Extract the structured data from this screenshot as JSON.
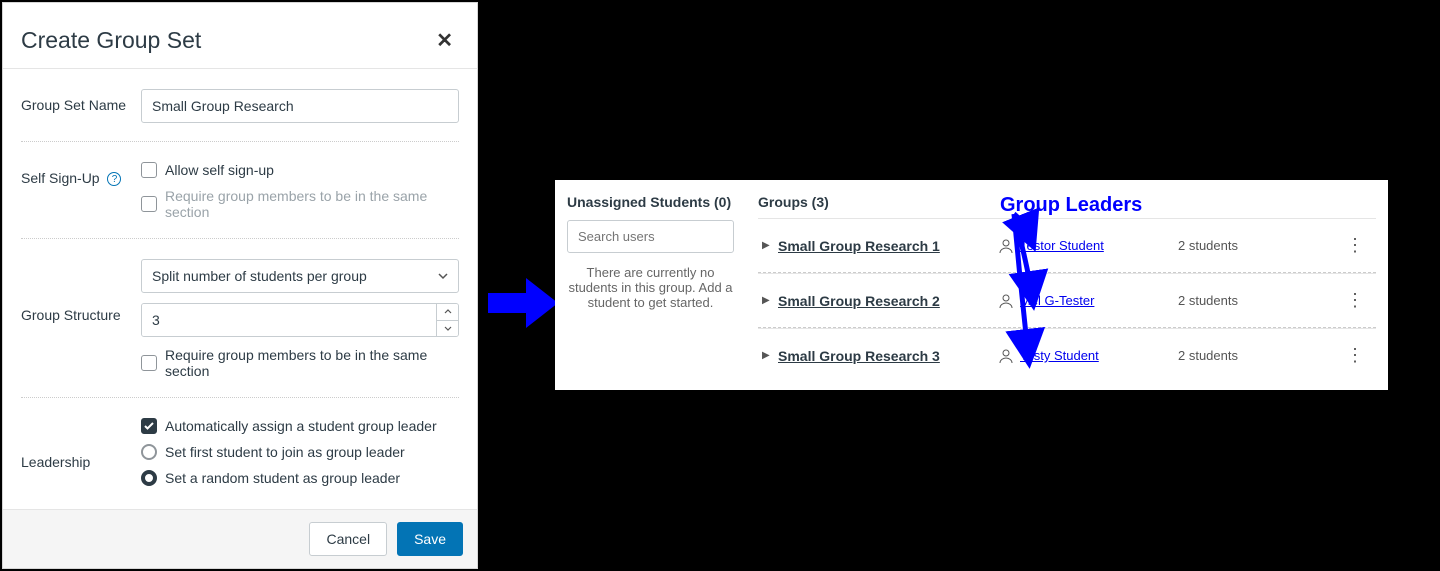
{
  "dialog": {
    "title": "Create Group Set",
    "group_set_name": {
      "label": "Group Set Name",
      "value": "Small Group Research"
    },
    "self_signup": {
      "label": "Self Sign-Up",
      "allow_label": "Allow self sign-up",
      "allow_checked": false,
      "same_section_label": "Require group members to be in the same section",
      "same_section_checked": false
    },
    "structure": {
      "label": "Group Structure",
      "split_option": "Split number of students per group",
      "count_value": "3",
      "same_section_label": "Require group members to be in the same section",
      "same_section_checked": false
    },
    "leadership": {
      "label": "Leadership",
      "auto_assign_label": "Automatically assign a student group leader",
      "auto_assign_checked": true,
      "radio_first_label": "Set first student to join as group leader",
      "radio_random_label": "Set a random student as group leader",
      "selected": "random"
    },
    "buttons": {
      "cancel": "Cancel",
      "save": "Save"
    }
  },
  "groups_panel": {
    "unassigned_title": "Unassigned Students (0)",
    "search_placeholder": "Search users",
    "empty_message": "There are currently no students in this group. Add a student to get started.",
    "groups_title": "Groups (3)",
    "rows": [
      {
        "name": " Small Group Research 1",
        "leader": "Testor Student",
        "count": "2 students"
      },
      {
        "name": " Small Group Research 2",
        "leader": "Mel G-Tester",
        "count": "2 students"
      },
      {
        "name": " Small Group Research 3",
        "leader": "Testy Student",
        "count": "2 students"
      }
    ]
  },
  "annotation": {
    "label": "Group Leaders"
  }
}
